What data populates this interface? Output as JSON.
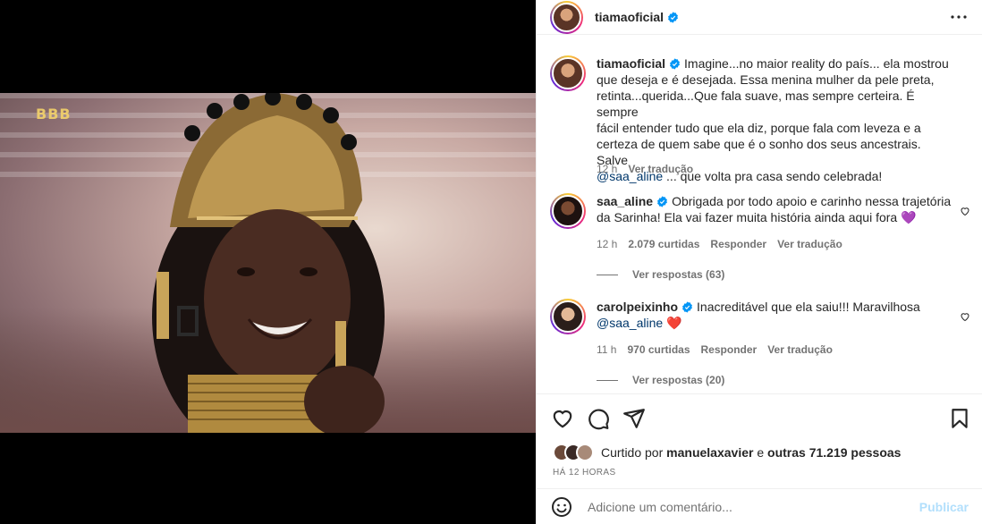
{
  "media": {
    "logo_text": "BBB"
  },
  "post": {
    "author": "tiamaoficial",
    "caption_user": "tiamaoficial",
    "caption_line1": "Imagine...no maior reality do país... ela mostrou",
    "caption_line2": "que deseja e é desejada. Essa menina mulher da pele preta,",
    "caption_line3": "retinta...querida...Que fala suave, mas sempre certeira. É sempre",
    "caption_line4": "fácil entender tudo que ela diz, porque fala com leveza e a",
    "caption_line5": "certeza de quem sabe que é o sonho dos seus ancestrais. Salve",
    "caption_mention": "@saa_aline",
    "caption_line6_rest": " ... que volta pra casa sendo celebrada!",
    "time": "12 h",
    "translate": "Ver tradução"
  },
  "comments": [
    {
      "user": "saa_aline",
      "line1": "Obrigada por todo apoio e carinho nessa trajetória",
      "line2": "da Sarinha! Ela vai fazer muita história ainda aqui fora",
      "emoji": "💜",
      "time": "12 h",
      "likes": "2.079 curtidas",
      "reply": "Responder",
      "translate": "Ver tradução",
      "view_replies": "Ver respostas (63)"
    },
    {
      "user": "carolpeixinho",
      "line1": "Inacreditável que ela saiu!!! Maravilhosa",
      "mention": "@saa_aline",
      "emoji": "❤️",
      "time": "11 h",
      "likes": "970 curtidas",
      "reply": "Responder",
      "translate": "Ver tradução",
      "view_replies": "Ver respostas (20)"
    }
  ],
  "actions": {
    "liked_prefix": "Curtido por ",
    "liked_user": "manuelaxavier",
    "liked_mid": " e ",
    "liked_others": "outras 71.219 pessoas",
    "ago": "HÁ 12 HORAS"
  },
  "add_comment": {
    "placeholder": "Adicione um comentário...",
    "publish": "Publicar"
  },
  "icons": [
    "more-icon",
    "verified-icon",
    "heart-icon",
    "comment-icon",
    "share-icon",
    "bookmark-icon",
    "emoji-icon"
  ],
  "colors": {
    "verified": "#0095f6",
    "mention": "#00376b",
    "publish_disabled": "#b2dffc"
  }
}
